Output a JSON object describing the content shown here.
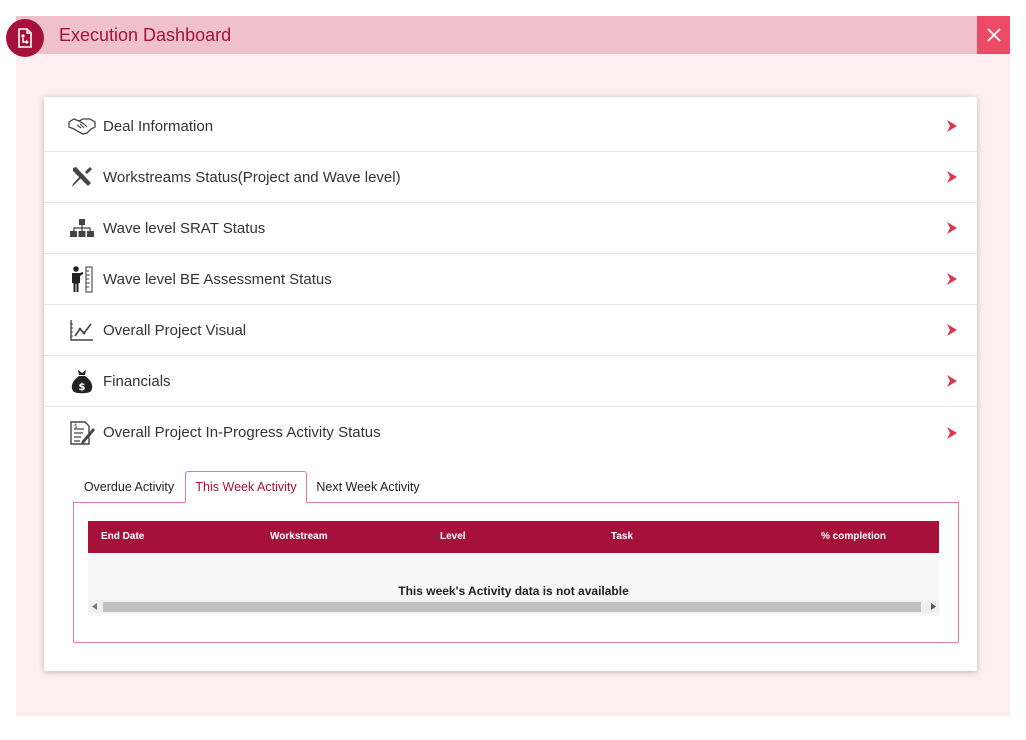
{
  "window": {
    "title": "Execution Dashboard"
  },
  "menu": [
    {
      "label": "Deal Information",
      "icon": "handshake-icon"
    },
    {
      "label": "Workstreams Status(Project and Wave level)",
      "icon": "tools-icon"
    },
    {
      "label": "Wave level SRAT Status",
      "icon": "hierarchy-icon"
    },
    {
      "label": "Wave level BE Assessment Status",
      "icon": "person-measure-icon"
    },
    {
      "label": "Overall Project Visual",
      "icon": "line-chart-icon"
    },
    {
      "label": "Financials",
      "icon": "money-bag-icon"
    },
    {
      "label": "Overall Project In-Progress Activity Status",
      "icon": "document-edit-icon"
    }
  ],
  "tabs": [
    {
      "label": "Overdue Activity",
      "active": false
    },
    {
      "label": "This Week Activity",
      "active": true
    },
    {
      "label": "Next Week Activity",
      "active": false
    }
  ],
  "table": {
    "columns": [
      "End Date",
      "Workstream",
      "Level",
      "Task",
      "% completion"
    ],
    "empty_message": "This week's Activity data is not available"
  },
  "colors": {
    "brand": "#a6113a",
    "titlebar": "#efc2cb",
    "close_button": "#ec4a67",
    "backdrop": "#fdeef1"
  }
}
